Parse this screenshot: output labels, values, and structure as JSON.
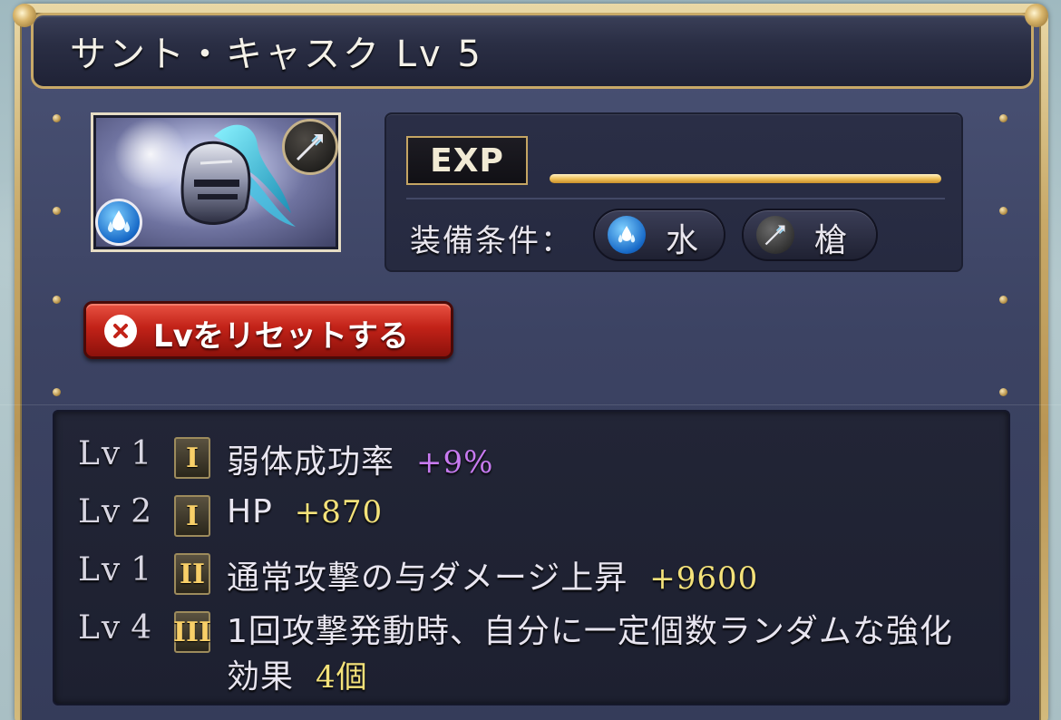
{
  "window": {
    "title": "サント・キャスク Lv 5"
  },
  "item": {
    "image_icon": "helmet-icon",
    "weapon_type_icon": "spear-icon",
    "element_icon": "water-icon"
  },
  "info": {
    "exp_label": "EXP",
    "exp_progress": 1.0,
    "requirement_label": "装備条件：",
    "requirements": [
      {
        "icon": "water-icon",
        "label": "水",
        "color": "#2a8ee8"
      },
      {
        "icon": "spear-icon",
        "label": "槍",
        "color": "#6b6b6b"
      }
    ]
  },
  "reset_button": {
    "label": "Lvをリセットする",
    "icon": "close-icon"
  },
  "skills": [
    {
      "lv_prefix": "Lv",
      "lv": "1",
      "tier": "I",
      "name": "弱体成功率",
      "value": "+9%",
      "value_color": "#c77af0"
    },
    {
      "lv_prefix": "Lv",
      "lv": "2",
      "tier": "I",
      "name": "HP",
      "value": "+870",
      "value_color": "#f4e27a"
    },
    {
      "lv_prefix": "Lv",
      "lv": "1",
      "tier": "II",
      "name": "通常攻撃の与ダメージ上昇",
      "value": "+9600",
      "value_color": "#f4e27a"
    },
    {
      "lv_prefix": "Lv",
      "lv": "4",
      "tier": "III",
      "name": "1回攻撃発動時、自分に一定個数ランダムな強化効果",
      "value": "4個",
      "value_color": "#f4e27a"
    }
  ],
  "colors": {
    "frame_gold": "#c8a968",
    "panel_navy": "#3c4363",
    "reset_red": "#c22218",
    "tier_gold": "#f8cf68"
  }
}
